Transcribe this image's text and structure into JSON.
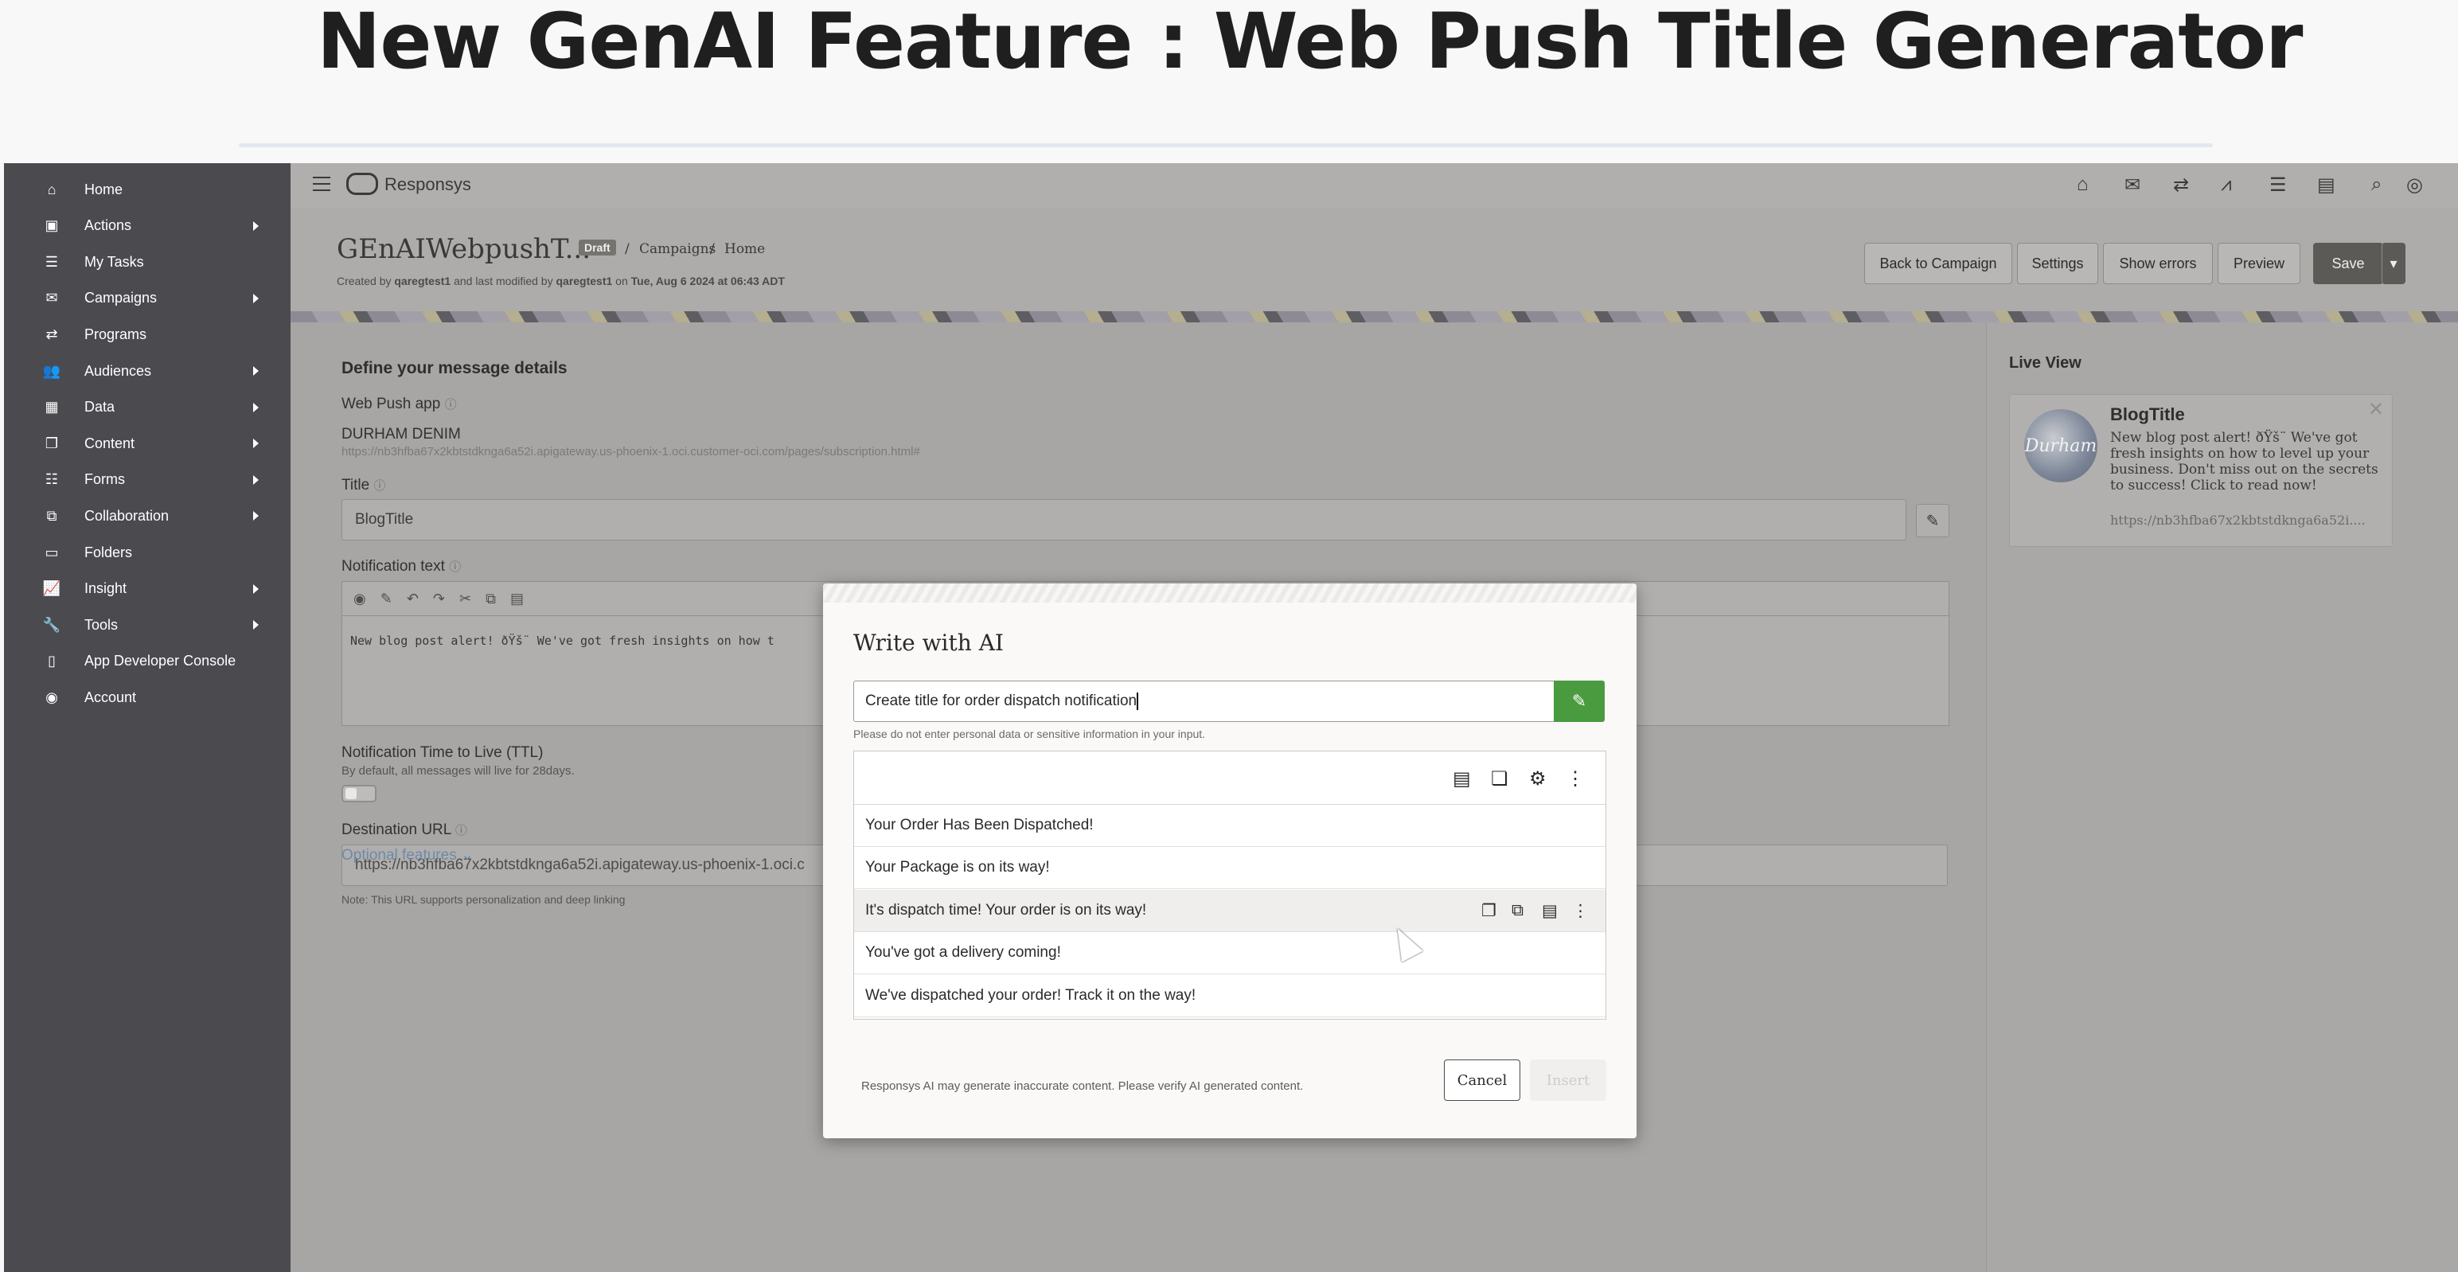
{
  "banner": {
    "title": "New GenAI Feature : Web Push Title Generator"
  },
  "sidebar": {
    "items": [
      {
        "label": "Home",
        "icon": "home-icon",
        "glyph": "⌂",
        "submenu": false
      },
      {
        "label": "Actions",
        "icon": "actions-icon",
        "glyph": "▣",
        "submenu": true
      },
      {
        "label": "My Tasks",
        "icon": "tasks-icon",
        "glyph": "☰",
        "submenu": false
      },
      {
        "label": "Campaigns",
        "icon": "campaigns-icon",
        "glyph": "✉",
        "submenu": true
      },
      {
        "label": "Programs",
        "icon": "programs-icon",
        "glyph": "⇄",
        "submenu": false
      },
      {
        "label": "Audiences",
        "icon": "audiences-icon",
        "glyph": "👥",
        "submenu": true
      },
      {
        "label": "Data",
        "icon": "data-icon",
        "glyph": "▦",
        "submenu": true
      },
      {
        "label": "Content",
        "icon": "content-icon",
        "glyph": "❐",
        "submenu": true
      },
      {
        "label": "Forms",
        "icon": "forms-icon",
        "glyph": "☷",
        "submenu": true
      },
      {
        "label": "Collaboration",
        "icon": "collaboration-icon",
        "glyph": "⧉",
        "submenu": true
      },
      {
        "label": "Folders",
        "icon": "folder-icon",
        "glyph": "▭",
        "submenu": false
      },
      {
        "label": "Insight",
        "icon": "insight-icon",
        "glyph": "📈",
        "submenu": true
      },
      {
        "label": "Tools",
        "icon": "tools-icon",
        "glyph": "🔧",
        "submenu": true
      },
      {
        "label": "App Developer Console",
        "icon": "developer-console-icon",
        "glyph": "▯",
        "submenu": false
      },
      {
        "label": "Account",
        "icon": "account-icon",
        "glyph": "◉",
        "submenu": false
      }
    ]
  },
  "topbar": {
    "brand": "Responsys"
  },
  "header": {
    "title": "GEnAIWebpushT...",
    "status": "Draft",
    "breadcrumb": [
      "Campaigns",
      "Home"
    ],
    "meta_prefix": "Created by ",
    "creator": "qaregtest1",
    "meta_mid": " and last modified by ",
    "modifier": "qaregtest1",
    "meta_on": " on ",
    "modified": "Tue, Aug 6 2024 at 06:43 ADT",
    "buttons": {
      "back": "Back to Campaign",
      "settings": "Settings",
      "errors": "Show errors",
      "preview": "Preview",
      "save": "Save"
    }
  },
  "form": {
    "section_title": "Define your message details",
    "app_label": "Web Push app",
    "app_name": "DURHAM DENIM",
    "app_url": "https://nb3hfba67x2kbtstdknga6a52i.apigateway.us-phoenix-1.oci.customer-oci.com/pages/subscription.html#",
    "title_label": "Title",
    "title_value": "BlogTitle",
    "notif_label": "Notification text",
    "notif_value": "New blog post alert! ðŸš¨ We've got fresh insights on how t",
    "ttl_label": "Notification Time to Live (TTL)",
    "ttl_hint": "By default, all messages will live for 28days.",
    "dest_label": "Destination URL",
    "dest_value": "https://nb3hfba67x2kbtstdknga6a52i.apigateway.us-phoenix-1.oci.c",
    "dest_note": "Note: This URL supports personalization and deep linking",
    "optional": "Optional features"
  },
  "liveview": {
    "title": "Live View",
    "card_title": "BlogTitle",
    "logo_text": "Durham",
    "body": "New blog post alert! ðŸš¨ We've got fresh insights on how to level up your business. Don't miss out on the secrets to success! Click to read now!",
    "url": "https://nb3hfba67x2kbtstdknga6a52i...."
  },
  "modal": {
    "title": "Write with AI",
    "prompt": "Create title for order dispatch notification",
    "disclaimer": "Please do not enter personal data or sensitive information in your input.",
    "results": [
      "Your Order Has Been Dispatched!",
      "Your Package is on its way!",
      "It's dispatch time! Your order is on its way!",
      "You've got a delivery coming!",
      "We've dispatched your order! Track it on the way!"
    ],
    "highlighted_index": 2,
    "footer_note": "Responsys AI may generate inaccurate content. Please verify AI generated content.",
    "cancel": "Cancel",
    "insert": "Insert"
  }
}
